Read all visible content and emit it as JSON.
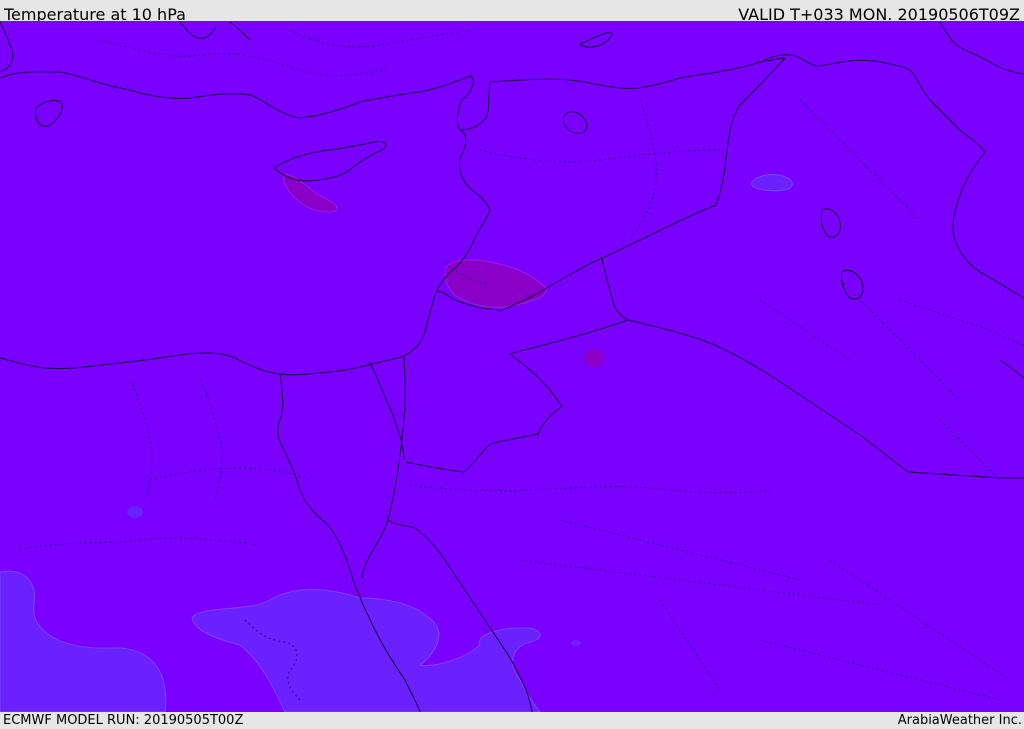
{
  "header": {
    "title": "Temperature at 10 hPa",
    "valid": "VALID T+033 MON. 20190506T09Z"
  },
  "footer": {
    "model_run": "ECMWF MODEL RUN: 20190505T00Z",
    "credit": "ArabiaWeather Inc."
  },
  "map": {
    "fill_color": "#7a00ff",
    "warm_patch_color": "#8a00c8",
    "cool_patch_color": "#6a20ff",
    "coast_color": "#1a0040",
    "border_color": "#1a0040"
  }
}
